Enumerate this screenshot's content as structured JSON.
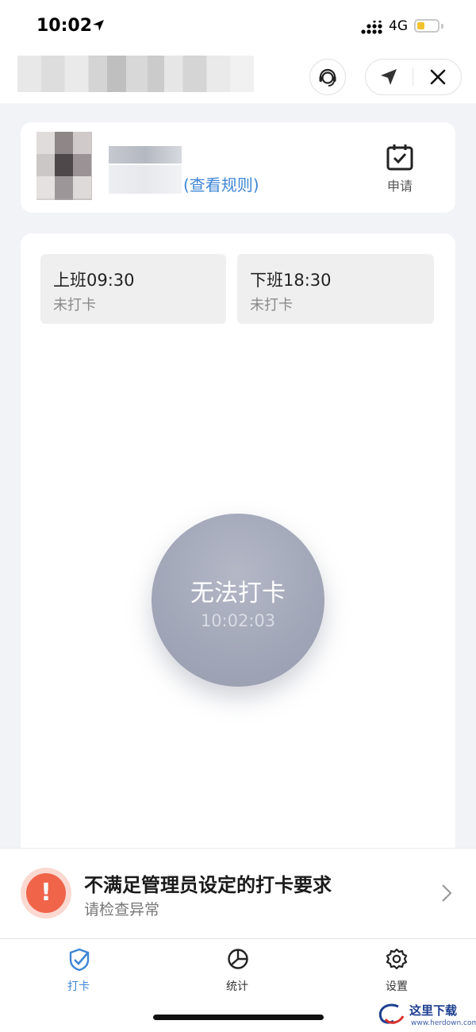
{
  "status_bar": {
    "time": "10:02",
    "network": "4G"
  },
  "header": {
    "title_blurred": true
  },
  "info_card": {
    "rule_link": "(查看规则)",
    "apply_label": "申请"
  },
  "shifts": [
    {
      "title": "上班09:30",
      "status": "未打卡"
    },
    {
      "title": "下班18:30",
      "status": "未打卡"
    }
  ],
  "punch_button": {
    "label": "无法打卡",
    "time": "10:02:03"
  },
  "alert": {
    "title": "不满足管理员设定的打卡要求",
    "subtitle": "请检查异常",
    "icon": "exclamation-icon",
    "color": "#f0644a"
  },
  "tabs": [
    {
      "label": "打卡",
      "icon": "check-badge-icon",
      "active": true
    },
    {
      "label": "统计",
      "icon": "pie-chart-icon",
      "active": false
    },
    {
      "label": "设置",
      "icon": "gear-icon",
      "active": false
    }
  ],
  "watermark": {
    "brand": "这里下载",
    "url": "www.herdown.com"
  },
  "colors": {
    "accent": "#3f86d6",
    "punch_bg": "#a3a8b9",
    "alert": "#f0644a"
  }
}
